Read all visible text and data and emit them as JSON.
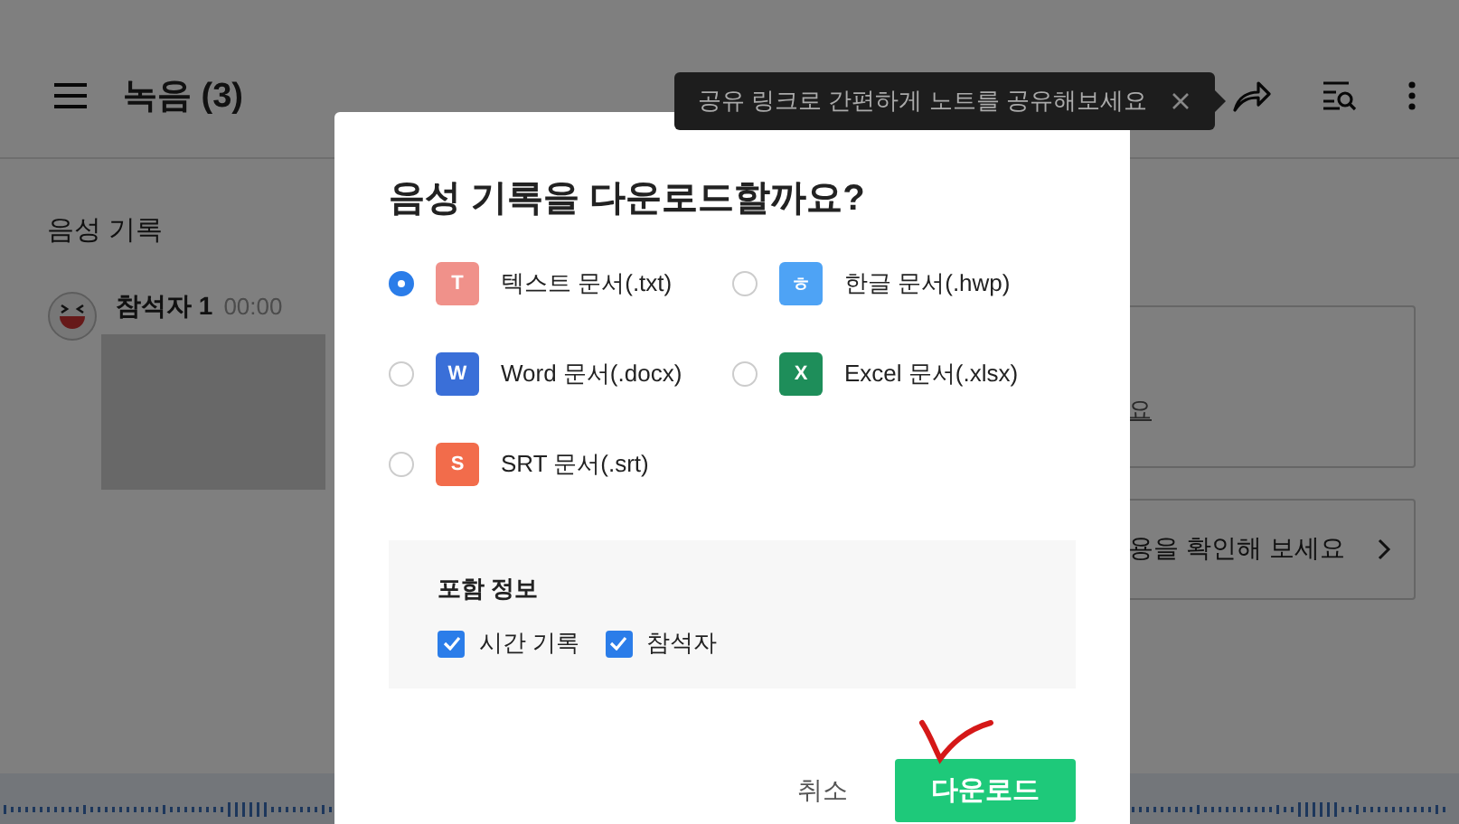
{
  "header": {
    "title": "녹음 (3)"
  },
  "tooltip": {
    "text": "공유 링크로 간편하게 노트를 공유해보세요"
  },
  "transcript": {
    "heading": "음성 기록",
    "speaker": "참석자 1",
    "time": "00:00"
  },
  "side_cards": [
    {
      "text": "요"
    },
    {
      "text": "용을 확인해 보세요"
    }
  ],
  "dialog": {
    "title": "음성 기록을 다운로드할까요?",
    "formats": [
      {
        "icon_letter": "T",
        "label": "텍스트 문서(.txt)",
        "selected": true,
        "color": "#f0918a"
      },
      {
        "icon_letter": "ㅎ",
        "label": "한글 문서(.hwp)",
        "selected": false,
        "color": "#4ea3f5"
      },
      {
        "icon_letter": "W",
        "label": "Word 문서(.docx)",
        "selected": false,
        "color": "#3a6fd8"
      },
      {
        "icon_letter": "X",
        "label": "Excel 문서(.xlsx)",
        "selected": false,
        "color": "#1e8e5a"
      },
      {
        "icon_letter": "S",
        "label": "SRT 문서(.srt)",
        "selected": false,
        "color": "#f26c4b"
      }
    ],
    "include": {
      "heading": "포함 정보",
      "options": [
        {
          "label": "시간 기록",
          "checked": true
        },
        {
          "label": "참석자",
          "checked": true
        }
      ]
    },
    "cancel": "취소",
    "confirm": "다운로드"
  }
}
